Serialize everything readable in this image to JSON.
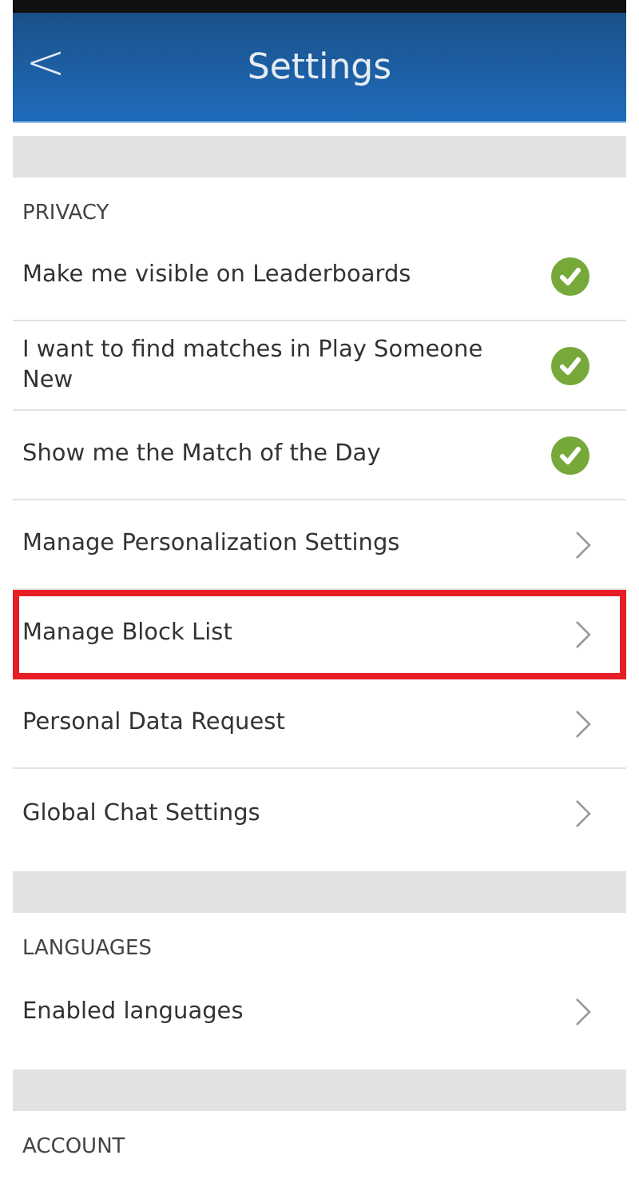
{
  "header": {
    "title": "Settings",
    "back": "<"
  },
  "sections": [
    {
      "title": "PRIVACY",
      "rows": [
        {
          "kind": "toggle",
          "label": "Make me visible on Leaderboards",
          "checked": true,
          "highlighted": false
        },
        {
          "kind": "toggle",
          "label": "I want to find matches in Play Someone New",
          "checked": true,
          "highlighted": false
        },
        {
          "kind": "toggle",
          "label": "Show me the Match of the Day",
          "checked": true,
          "highlighted": false
        },
        {
          "kind": "link",
          "label": "Manage Personalization Settings",
          "highlighted": false
        },
        {
          "kind": "link",
          "label": "Manage Block List",
          "highlighted": true
        },
        {
          "kind": "link",
          "label": "Personal Data Request",
          "highlighted": false
        },
        {
          "kind": "link",
          "label": "Global Chat Settings",
          "highlighted": false
        }
      ]
    },
    {
      "title": "LANGUAGES",
      "rows": [
        {
          "kind": "link",
          "label": "Enabled languages",
          "highlighted": false
        }
      ]
    },
    {
      "title": "ACCOUNT"
    }
  ]
}
